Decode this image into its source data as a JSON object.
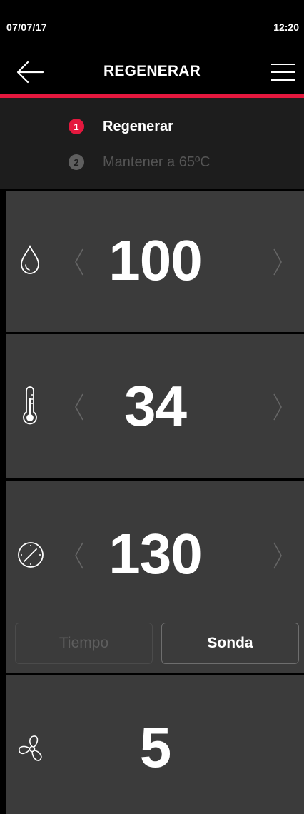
{
  "status": {
    "date": "07/07/17",
    "time": "12:20"
  },
  "header": {
    "title": "REGENERAR"
  },
  "steps": [
    {
      "num": "1",
      "label": "Regenerar"
    },
    {
      "num": "2",
      "label": "Mantener a 65ºC"
    }
  ],
  "settings": {
    "humidity": {
      "value": "100",
      "icon": "drop-icon"
    },
    "temperature": {
      "value": "34",
      "icon": "thermometer-icon"
    },
    "time": {
      "value": "130",
      "icon": "clock-icon"
    },
    "mode": {
      "option1": "Tiempo",
      "option2": "Sonda",
      "selected": "Sonda"
    },
    "fan": {
      "value": "5",
      "icon": "fan-icon"
    }
  },
  "colors": {
    "accent": "#e4183e",
    "panel": "#3b3b3b",
    "background": "#000000"
  }
}
